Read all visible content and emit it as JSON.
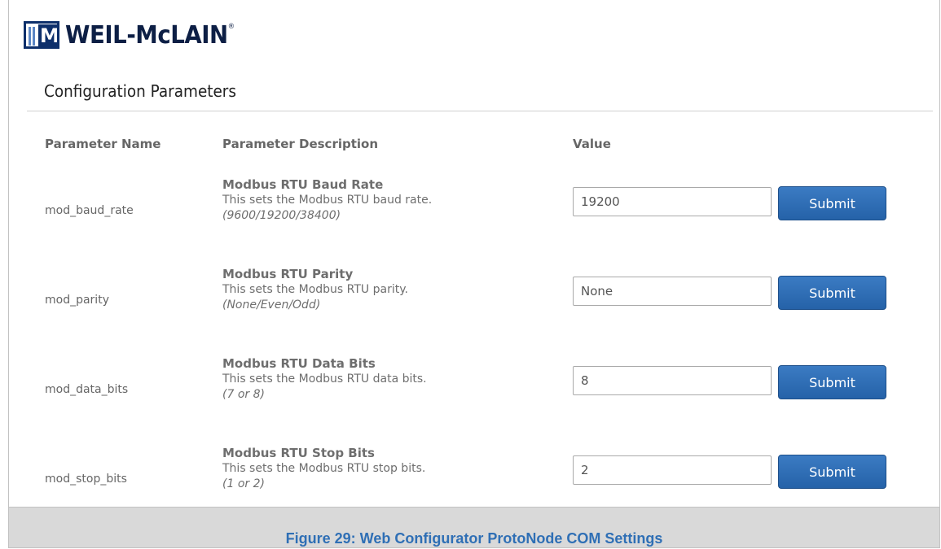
{
  "brand": {
    "logo_mark": "WM",
    "logo_text": "WEIL-McLAIN",
    "registered": "®"
  },
  "page": {
    "title": "Configuration Parameters"
  },
  "table": {
    "headers": {
      "name": "Parameter Name",
      "description": "Parameter Description",
      "value": "Value"
    },
    "submit_label": "Submit",
    "rows": [
      {
        "name": "mod_baud_rate",
        "title": "Modbus RTU Baud Rate",
        "description": "This sets the Modbus RTU baud rate.",
        "range": "(9600/19200/38400)",
        "value": "19200"
      },
      {
        "name": "mod_parity",
        "title": "Modbus RTU Parity",
        "description": "This sets the Modbus RTU parity.",
        "range": "(None/Even/Odd)",
        "value": "None"
      },
      {
        "name": "mod_data_bits",
        "title": "Modbus RTU Data Bits",
        "description": "This sets the Modbus RTU data bits.",
        "range": "(7 or 8)",
        "value": "8"
      },
      {
        "name": "mod_stop_bits",
        "title": "Modbus RTU Stop Bits",
        "description": "This sets the Modbus RTU stop bits.",
        "range": "(1 or 2)",
        "value": "2"
      }
    ]
  },
  "caption": "Figure 29: Web Configurator ProtoNode COM Settings",
  "colors": {
    "brand_navy": "#0d2f6b",
    "button_blue": "#2f6fb5",
    "caption_blue": "#2f6fb5"
  }
}
